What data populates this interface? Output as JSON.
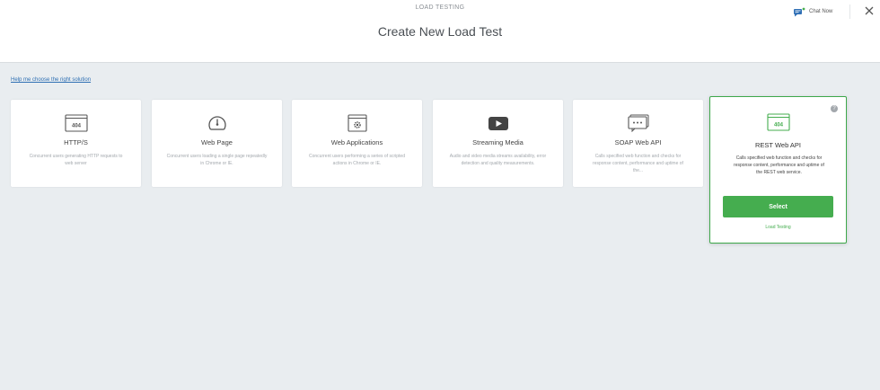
{
  "header": {
    "eyebrow": "LOAD TESTING",
    "title": "Create New Load Test",
    "chat_label": "Chat Now"
  },
  "help_link": "Help me choose the right solution",
  "cards": [
    {
      "icon": "http-404-icon",
      "title": "HTTP/S",
      "description": "Concurrent users generating HTTP requests to web server"
    },
    {
      "icon": "speedometer-icon",
      "title": "Web Page",
      "description": "Concurrent users loading a single page repeatedly in Chrome or IE."
    },
    {
      "icon": "web-app-gear-icon",
      "title": "Web Applications",
      "description": "Concurrent users performing a series of scripted actions in Chrome or IE."
    },
    {
      "icon": "play-video-icon",
      "title": "Streaming Media",
      "description": "Audio and video media streams availability, error detection and quality measurements."
    },
    {
      "icon": "soap-api-icon",
      "title": "SOAP Web API",
      "description": "Calls specified web function and checks for response content, performance and uptime of the..."
    },
    {
      "icon": "rest-api-404-icon",
      "title": "REST Web API",
      "description": "Calls specified web function and checks for response content, performance and uptime of the REST web service.",
      "button_label": "Select",
      "sub_label": "Load Testing",
      "help_mark": "?"
    }
  ],
  "colors": {
    "accent_green": "#45ad4f",
    "link_blue": "#2e6fb3",
    "background": "#e9edf0"
  }
}
